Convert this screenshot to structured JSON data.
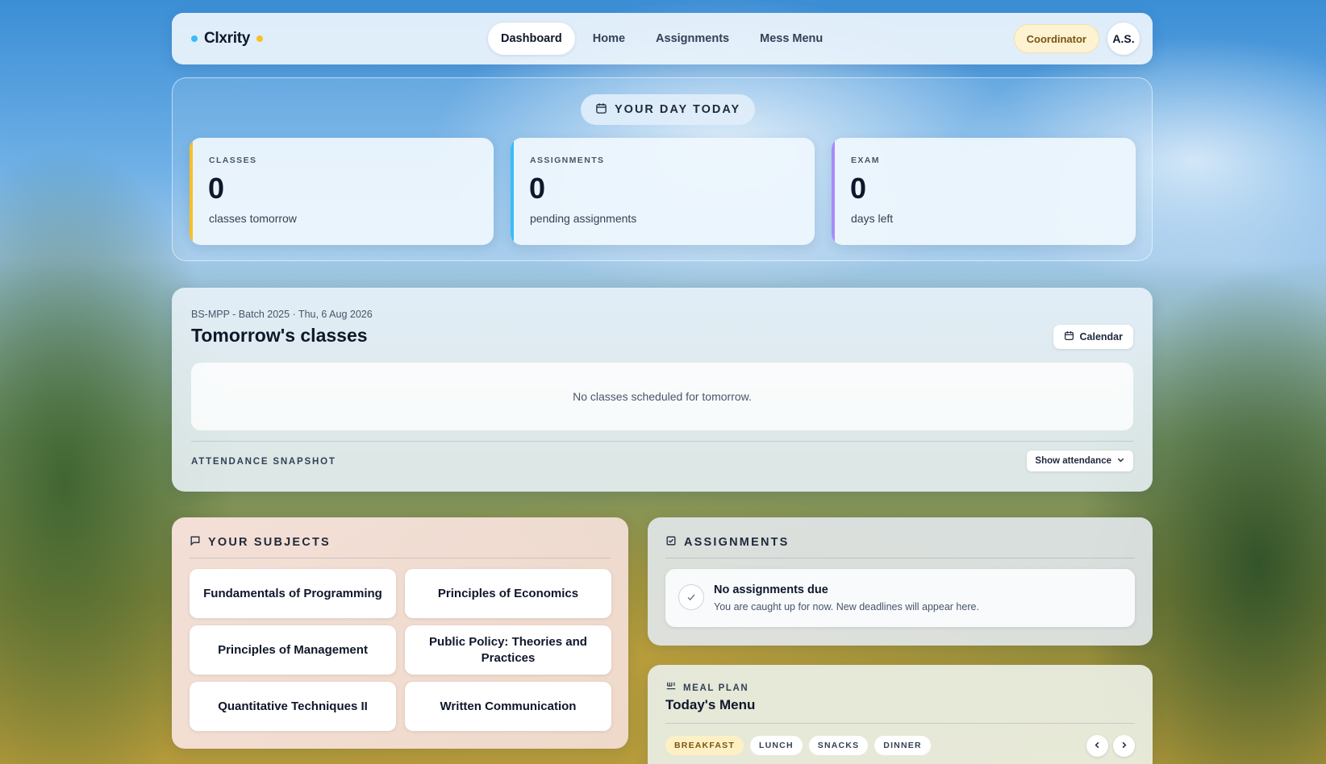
{
  "nav": {
    "brand": "Clxrity",
    "brand_dot_left_color": "#38bdf8",
    "brand_dot_right_color": "#fbbf24",
    "links": [
      "Dashboard",
      "Home",
      "Assignments",
      "Mess Menu"
    ],
    "active_link": "Dashboard",
    "role": "Coordinator",
    "avatar": "A.S."
  },
  "today": {
    "pill_label": "YOUR DAY TODAY",
    "pill_icon": "calendar-icon",
    "cards": [
      {
        "label": "CLASSES",
        "value": "0",
        "sub": "classes tomorrow",
        "accent": "#fbbf24"
      },
      {
        "label": "ASSIGNMENTS",
        "value": "0",
        "sub": "pending assignments",
        "accent": "#38bdf8"
      },
      {
        "label": "EXAM",
        "value": "0",
        "sub": "days left",
        "accent": "#a78bfa"
      }
    ]
  },
  "tomorrow": {
    "meta": "BS-MPP - Batch 2025 · Thu, 6 Aug 2026",
    "title": "Tomorrow's classes",
    "calendar_button": "Calendar",
    "empty_text": "No classes scheduled for tomorrow.",
    "attendance_label": "ATTENDANCE SNAPSHOT",
    "attendance_button": "Show attendance"
  },
  "subjects": {
    "heading": "YOUR SUBJECTS",
    "icon": "chat-icon",
    "items": [
      "Fundamentals of Programming",
      "Principles of Economics",
      "Principles of Management",
      "Public Policy: Theories and Practices",
      "Quantitative Techniques II",
      "Written Communication"
    ]
  },
  "assignments": {
    "heading": "ASSIGNMENTS",
    "icon": "checkbox-icon",
    "empty_title": "No assignments due",
    "empty_sub": "You are caught up for now. New deadlines will appear here."
  },
  "meal": {
    "heading": "MEAL PLAN",
    "icon": "utensils-icon",
    "title": "Today's Menu",
    "tabs": [
      "BREAKFAST",
      "LUNCH",
      "SNACKS",
      "DINNER"
    ],
    "active_tab": "BREAKFAST"
  }
}
